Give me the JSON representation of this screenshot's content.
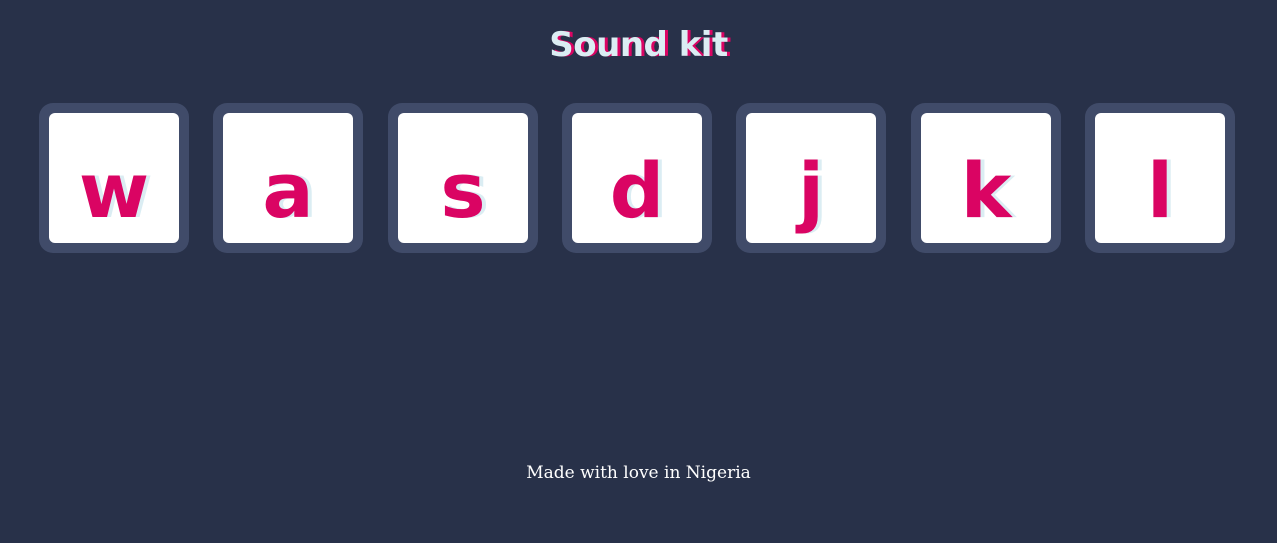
{
  "header": {
    "title": "Sound kit"
  },
  "pads": [
    {
      "key": "w"
    },
    {
      "key": "a"
    },
    {
      "key": "s"
    },
    {
      "key": "d"
    },
    {
      "key": "j"
    },
    {
      "key": "k"
    },
    {
      "key": "l"
    }
  ],
  "footer": {
    "text": "Made with love in Nigeria"
  },
  "colors": {
    "background": "#283149",
    "pad_frame": "#404B69",
    "pad_face": "#FFFFFF",
    "accent": "#DA0463",
    "title_fill": "#DBEDF3"
  }
}
